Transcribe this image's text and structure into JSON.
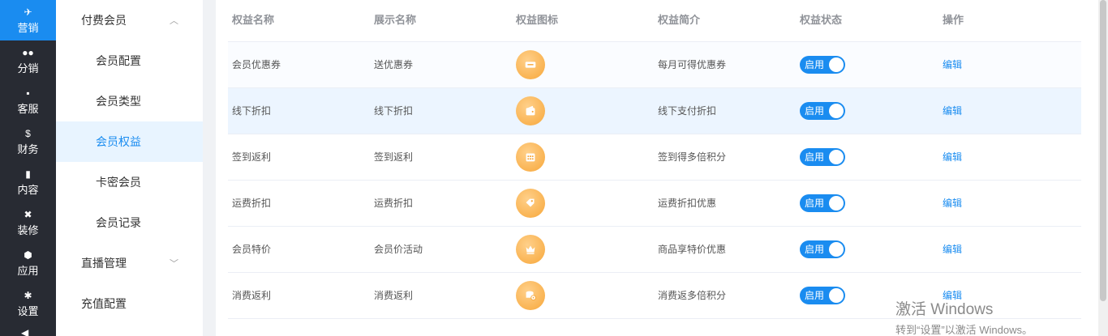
{
  "nav_primary": [
    {
      "label": "营销",
      "icon": "send-icon",
      "glyph": "✈",
      "active": true
    },
    {
      "label": "分销",
      "icon": "users-icon",
      "glyph": "●●",
      "active": false
    },
    {
      "label": "客服",
      "icon": "chat-icon",
      "glyph": "▪",
      "active": false
    },
    {
      "label": "财务",
      "icon": "dollar-icon",
      "glyph": "$",
      "active": false
    },
    {
      "label": "内容",
      "icon": "book-icon",
      "glyph": "▮",
      "active": false
    },
    {
      "label": "装修",
      "icon": "tools-icon",
      "glyph": "✖",
      "active": false
    },
    {
      "label": "应用",
      "icon": "cube-icon",
      "glyph": "⬢",
      "active": false
    },
    {
      "label": "设置",
      "icon": "gear-icon",
      "glyph": "✱",
      "active": false
    }
  ],
  "nav_secondary": {
    "group1": "付费会员",
    "items": [
      "会员配置",
      "会员类型",
      "会员权益",
      "卡密会员",
      "会员记录"
    ],
    "active_index": 2,
    "group2": "直播管理",
    "group3": "充值配置"
  },
  "table": {
    "headers": [
      "权益名称",
      "展示名称",
      "权益图标",
      "权益简介",
      "权益状态",
      "操作"
    ],
    "rows": [
      {
        "name": "会员优惠券",
        "display": "送优惠券",
        "icon": "coupon-icon",
        "intro": "每月可得优惠券",
        "status": "启用",
        "action": "编辑"
      },
      {
        "name": "线下折扣",
        "display": "线下折扣",
        "icon": "wallet-icon",
        "intro": "线下支付折扣",
        "status": "启用",
        "action": "编辑"
      },
      {
        "name": "签到返利",
        "display": "签到返利",
        "icon": "calendar-icon",
        "intro": "签到得多倍积分",
        "status": "启用",
        "action": "编辑"
      },
      {
        "name": "运费折扣",
        "display": "运费折扣",
        "icon": "tag-icon",
        "intro": "运费折扣优惠",
        "status": "启用",
        "action": "编辑"
      },
      {
        "name": "会员特价",
        "display": "会员价活动",
        "icon": "crown-icon",
        "intro": "商品享特价优惠",
        "status": "启用",
        "action": "编辑"
      },
      {
        "name": "消费返利",
        "display": "消费返利",
        "icon": "coins-icon",
        "intro": "消费返多倍积分",
        "status": "启用",
        "action": "编辑"
      }
    ]
  },
  "watermark": {
    "line1": "激活 Windows",
    "line2": "转到“设置”以激活 Windows。"
  }
}
